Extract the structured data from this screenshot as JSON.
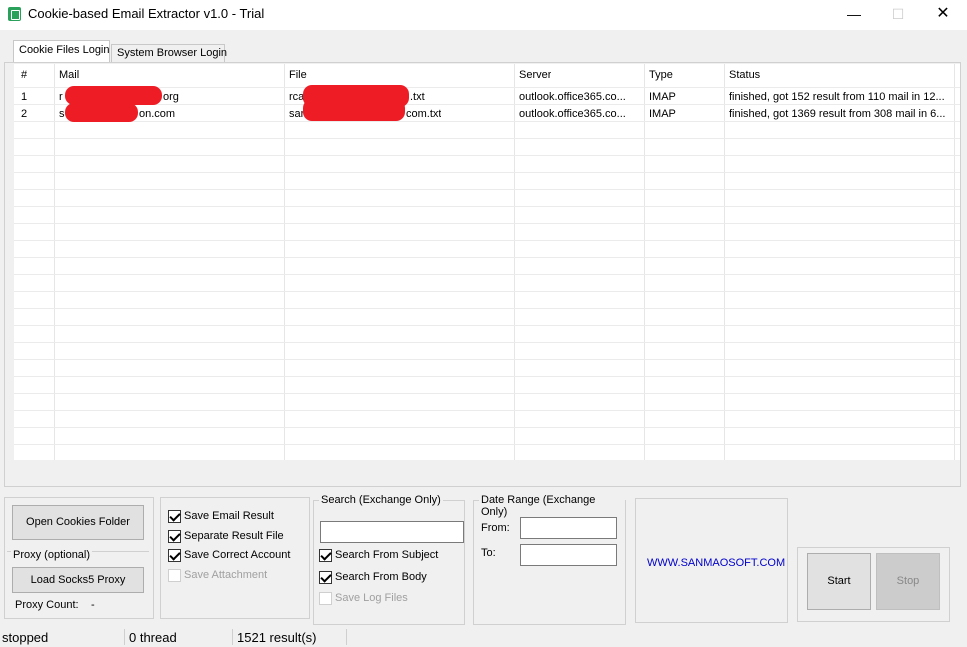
{
  "window": {
    "title": "Cookie-based Email Extractor v1.0 - Trial",
    "minimize_glyph": "—",
    "maximize_glyph": "☐",
    "close_glyph": "✕"
  },
  "tabs": [
    {
      "label": "Cookie Files Login",
      "active": true
    },
    {
      "label": "System Browser Login",
      "active": false
    }
  ],
  "table": {
    "columns": [
      "#",
      "Mail",
      "File",
      "Server",
      "Type",
      "Status"
    ],
    "rows": [
      {
        "num": "1",
        "mail_prefix": "r",
        "mail_suffix": "org",
        "file_prefix": "rca",
        "file_suffix": ".txt",
        "server": "outlook.office365.co...",
        "type": "IMAP",
        "status": "finished, got 152 result from 110 mail in 12..."
      },
      {
        "num": "2",
        "mail_prefix": "s",
        "mail_suffix": "on.com",
        "file_prefix": "sar",
        "file_suffix": "com.txt",
        "server": "outlook.office365.co...",
        "type": "IMAP",
        "status": "finished, got 1369 result from 308 mail in 6..."
      }
    ]
  },
  "left_panel": {
    "open_cookies_label": "Open Cookies Folder",
    "proxy_group_label": "Proxy (optional)",
    "load_proxy_label": "Load Socks5 Proxy",
    "proxy_count_label": "Proxy Count:",
    "proxy_count_value": "-"
  },
  "options": {
    "save_email_result": {
      "label": "Save Email Result",
      "checked": true
    },
    "separate_result_file": {
      "label": "Separate Result File",
      "checked": true
    },
    "save_correct_account": {
      "label": "Save Correct Account",
      "checked": true
    },
    "save_attachment": {
      "label": "Save Attachment",
      "checked": false,
      "disabled": true
    }
  },
  "search": {
    "group_label": "Search (Exchange Only)",
    "query_value": "",
    "search_from_subject": {
      "label": "Search From Subject",
      "checked": true
    },
    "search_from_body": {
      "label": "Search From Body",
      "checked": true
    },
    "save_log_files": {
      "label": "Save Log Files",
      "checked": false,
      "disabled": true
    }
  },
  "date_range": {
    "group_label": "Date Range (Exchange Only)",
    "from_label": "From:",
    "from_value": "",
    "to_label": "To:",
    "to_value": ""
  },
  "website": {
    "text": "WWW.SANMAOSOFT.COM",
    "color": "#0000cc"
  },
  "actions": {
    "start_label": "Start",
    "stop_label": "Stop"
  },
  "status_bar": {
    "state": "stopped",
    "threads": "0 thread",
    "results": "1521 result(s)"
  },
  "colors": {
    "redaction": "#ee1c25",
    "app_icon": "#2aa15a"
  }
}
